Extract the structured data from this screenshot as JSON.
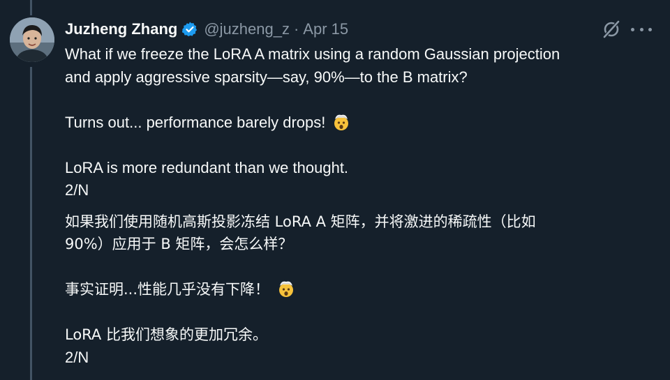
{
  "tweet": {
    "author_name": "Juzheng Zhang",
    "handle": "@juzheng_z",
    "separator": "·",
    "date": "Apr 15",
    "verified": true,
    "colors": {
      "background": "#15202b",
      "text": "#f7f9f9",
      "muted": "#8b98a5",
      "verified": "#1d9bf0"
    },
    "icons": [
      "verified-badge-icon",
      "grok-icon",
      "more-options-icon",
      "exploding-head-emoji-icon"
    ],
    "english": {
      "line1": "What if we freeze the LoRA A matrix using a random Gaussian projection",
      "line2": "and apply aggressive sparsity—say, 90%—to the B matrix?",
      "line3": "Turns out... performance barely drops!",
      "line4": "LoRA is more redundant than we thought.",
      "line5": "2/N"
    },
    "chinese": {
      "line1": "如果我们使用随机高斯投影冻结 LoRA A 矩阵，并将激进的稀疏性（比如",
      "line2": "90%）应用于 B 矩阵，会怎么样？",
      "line3": "事实证明...性能几乎没有下降！",
      "line4": "LoRA 比我们想象的更加冗余。",
      "line5": "2/N"
    }
  }
}
